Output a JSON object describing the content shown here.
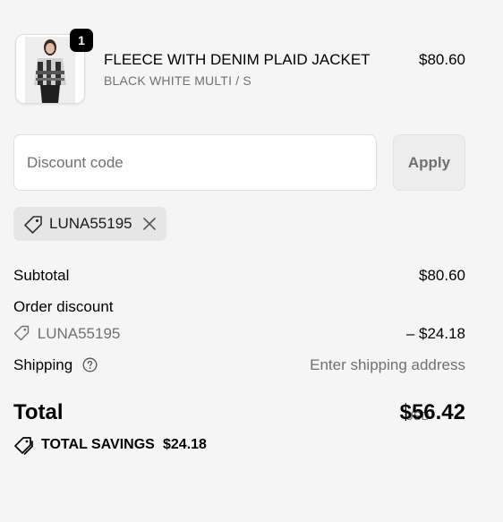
{
  "product": {
    "quantity": "1",
    "name": "FLEECE WITH DENIM PLAID JACKET",
    "variant": "BLACK WHITE MULTI / S",
    "price": "$80.60"
  },
  "discount": {
    "placeholder": "Discount code",
    "value": "",
    "apply_label": "Apply",
    "applied_code": "LUNA55195"
  },
  "summary": {
    "subtotal_label": "Subtotal",
    "subtotal_value": "$80.60",
    "order_discount_label": "Order discount",
    "order_discount_code": "LUNA55195",
    "order_discount_value": "– $24.18",
    "shipping_label": "Shipping",
    "shipping_value": "Enter shipping address",
    "total_label": "Total",
    "currency": "USD",
    "total_value": "$56.42",
    "savings_label": "TOTAL SAVINGS",
    "savings_value": "$24.18"
  },
  "icons": {
    "tag": "tag-icon",
    "close": "close-icon",
    "help": "question-circle-icon",
    "savings": "double-tag-icon"
  }
}
